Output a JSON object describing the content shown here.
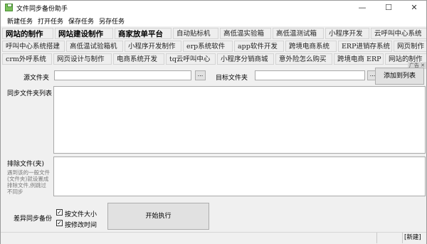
{
  "window": {
    "title": "文件同步备份助手",
    "minimize": "—",
    "maximize": "☐",
    "close": "✕"
  },
  "menu": [
    "新建任务",
    "打开任务",
    "保存任务",
    "另存任务"
  ],
  "ads": {
    "row1": [
      "网站的制作",
      "网站建设制作",
      "商家放单平台",
      "自动贴标机",
      "高低温实验箱",
      "高低温测试箱",
      "小程序开发",
      "云呼叫中心系统"
    ],
    "row2": [
      "呼叫中心系统搭建",
      "高低温试验箱机",
      "小程序开发制作",
      "erp系统软件",
      "app软件开发",
      "跨境电商系统",
      "ERP进销存系统",
      "网页制作"
    ],
    "row3": [
      "crm外呼系统",
      "网页设计与制作",
      "电商系统开发",
      "tq云呼叫中心",
      "小程序分销商城",
      "意外险怎么购买",
      "跨境电商 ERP",
      "网站的制作"
    ],
    "close_label": "广告 ✕"
  },
  "form": {
    "source_label": "源文件夹",
    "target_label": "目标文件夹",
    "browse_label": "...",
    "add_button": "添加到列表",
    "list_label": "同步文件夹列表",
    "exclude_label": "排除文件(夹)",
    "exclude_hint": "遇到该的一般文件(文件夹)就设置成排除文件,例跳过不同步",
    "mode_label": "差异同步备份",
    "check_size_label": "按文件大小",
    "check_time_label": "按修改时间",
    "check_size": true,
    "check_time": true,
    "start_button": "开始执行"
  },
  "status": {
    "right_text": "[新建]"
  }
}
